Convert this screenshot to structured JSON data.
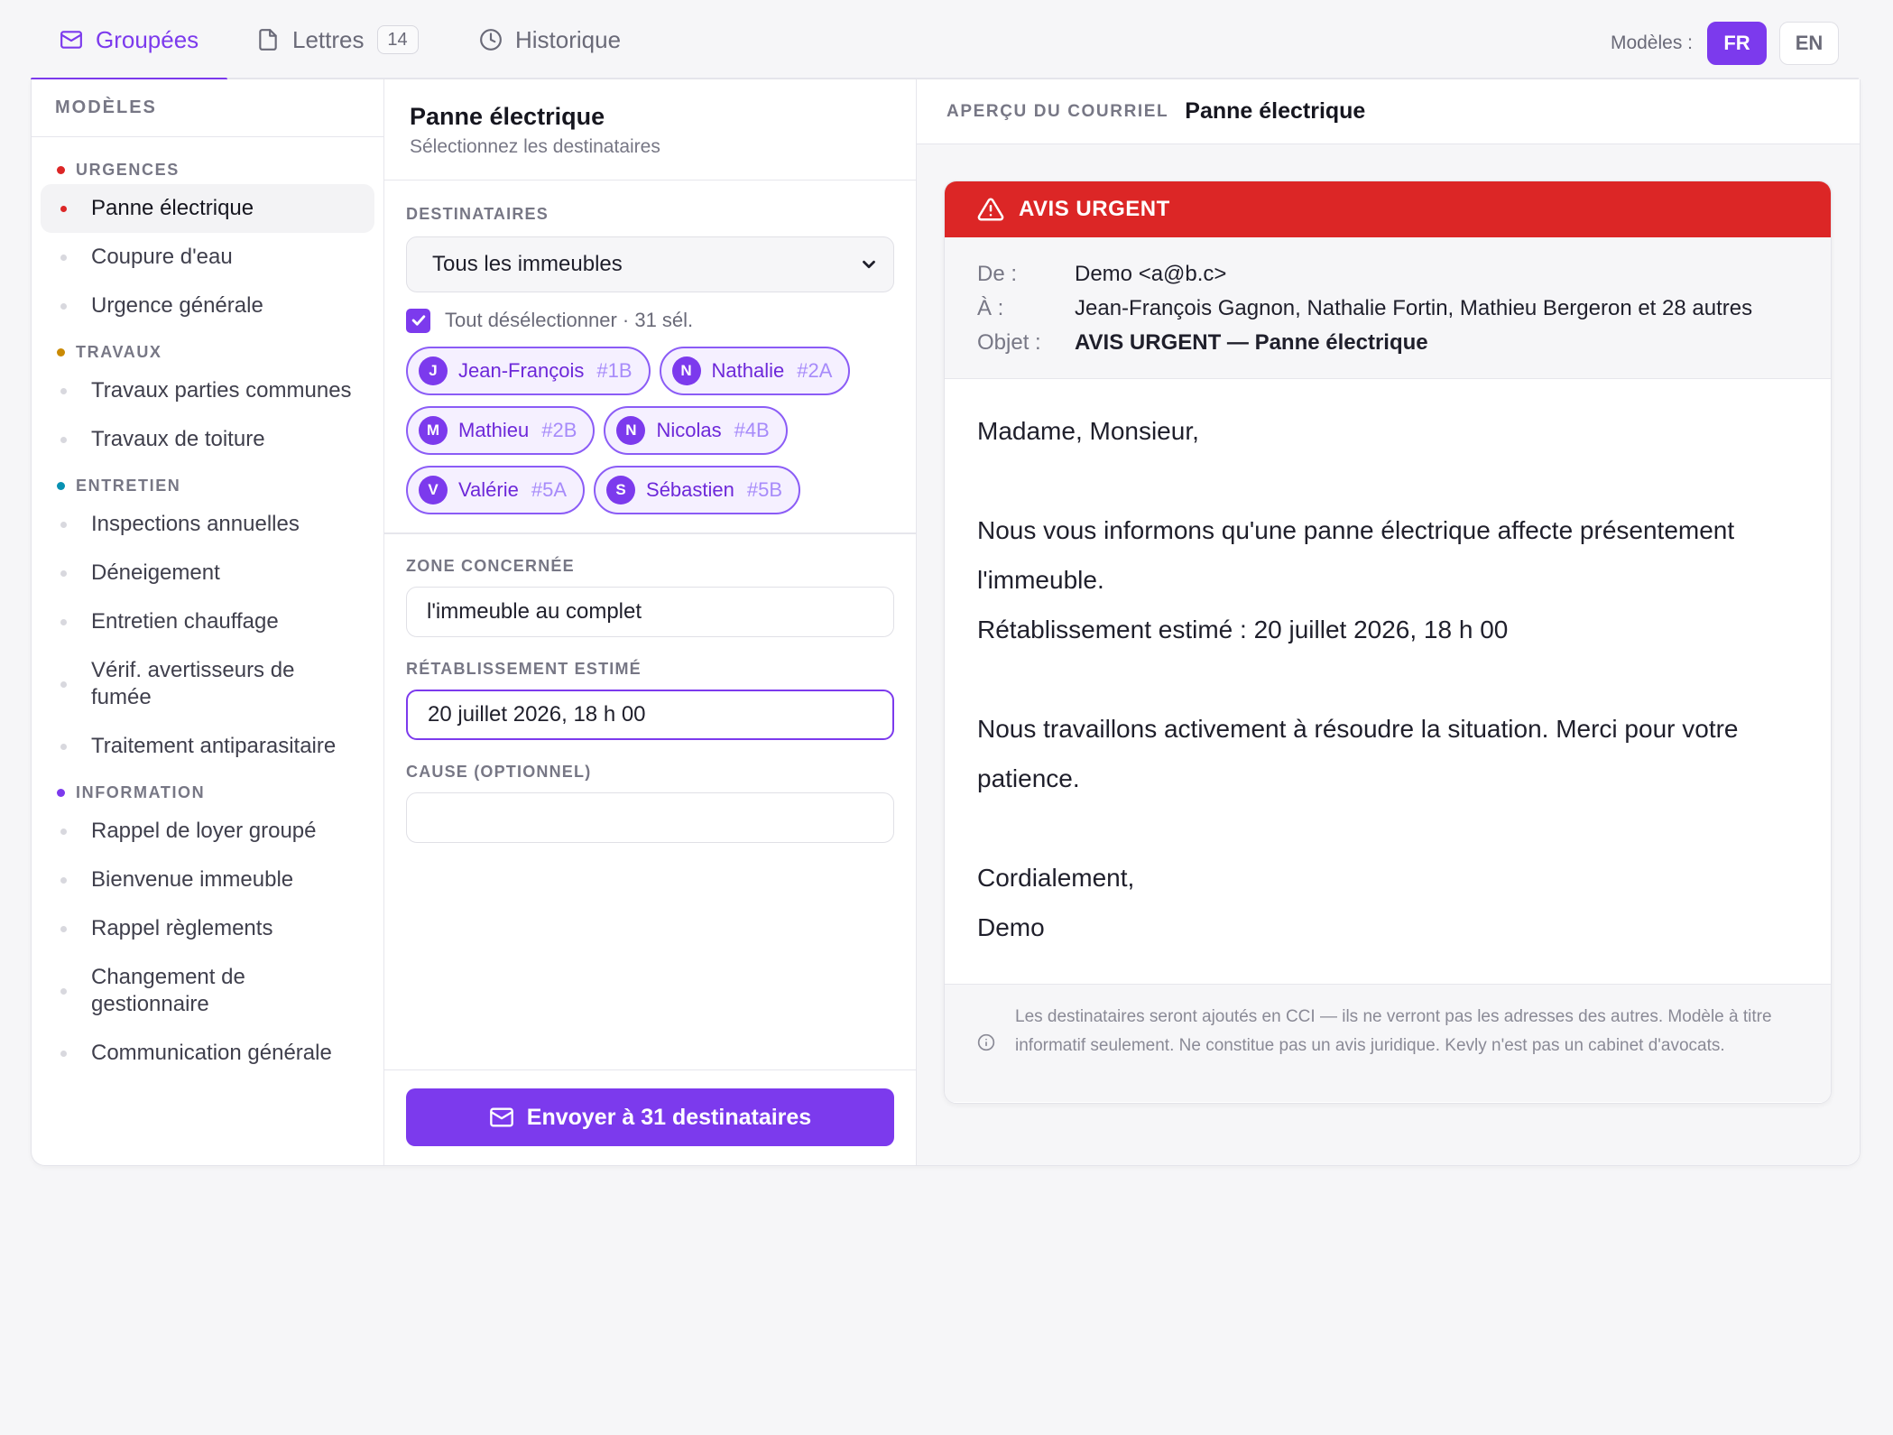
{
  "tabs": [
    {
      "label": "Groupées",
      "icon": "mail-icon"
    },
    {
      "label": "Lettres",
      "icon": "document-icon",
      "count": "14"
    },
    {
      "label": "Historique",
      "icon": "clock-icon"
    }
  ],
  "lang": {
    "label": "Modèles :",
    "options": [
      "FR",
      "EN"
    ],
    "selected": "FR"
  },
  "sidebar": {
    "title": "MODÈLES",
    "groups": [
      {
        "label": "URGENCES",
        "color": "#dc2626",
        "items": [
          "Panne électrique",
          "Coupure d'eau",
          "Urgence générale"
        ]
      },
      {
        "label": "TRAVAUX",
        "color": "#ca8a04",
        "items": [
          "Travaux parties communes",
          "Travaux de toiture"
        ]
      },
      {
        "label": "ENTRETIEN",
        "color": "#0891b2",
        "items": [
          "Inspections annuelles",
          "Déneigement",
          "Entretien chauffage",
          "Vérif. avertisseurs de fumée",
          "Traitement antiparasitaire"
        ]
      },
      {
        "label": "INFORMATION",
        "color": "#7c3aed",
        "items": [
          "Rappel de loyer groupé",
          "Bienvenue immeuble",
          "Rappel règlements",
          "Changement de gestionnaire",
          "Communication générale"
        ]
      }
    ],
    "active": "Panne électrique"
  },
  "form": {
    "title": "Panne électrique",
    "subtitle": "Sélectionnez les destinataires",
    "recipients_label": "DESTINATAIRES",
    "building_select": "Tous les immeubles",
    "deselect_all": "Tout désélectionner · 31 sél.",
    "chips": [
      {
        "initial": "J",
        "name": "Jean-François",
        "unit": "#1B"
      },
      {
        "initial": "N",
        "name": "Nathalie",
        "unit": "#2A"
      },
      {
        "initial": "M",
        "name": "Mathieu",
        "unit": "#2B"
      },
      {
        "initial": "N",
        "name": "Nicolas",
        "unit": "#4B"
      },
      {
        "initial": "V",
        "name": "Valérie",
        "unit": "#5A"
      },
      {
        "initial": "S",
        "name": "Sébastien",
        "unit": "#5B"
      }
    ],
    "zone_label": "ZONE CONCERNÉE",
    "zone_value": "l'immeuble au complet",
    "restore_label": "RÉTABLISSEMENT ESTIMÉ",
    "restore_value": "20 juillet 2026, 18 h 00",
    "cause_label": "CAUSE (OPTIONNEL)",
    "cause_value": "",
    "send_label": "Envoyer à 31 destinataires"
  },
  "preview": {
    "label": "APERÇU DU COURRIEL",
    "title": "Panne électrique",
    "banner": "AVIS URGENT",
    "from_key": "De :",
    "from": "Demo <a@b.c>",
    "to_key": "À :",
    "to": "Jean-François Gagnon, Nathalie Fortin, Mathieu Bergeron et 28 autres",
    "subject_key": "Objet :",
    "subject": "AVIS URGENT — Panne électrique",
    "body": {
      "greeting": "Madame, Monsieur,",
      "p1": "Nous vous informons qu'une panne électrique affecte présentement l'immeuble.",
      "p2": "Rétablissement estimé : 20 juillet 2026, 18 h 00",
      "p3": "Nous travaillons activement à résoudre la situation. Merci pour votre patience.",
      "closing": "Cordialement,",
      "signature": "Demo"
    },
    "disclaimer": "Les destinataires seront ajoutés en CCI — ils ne verront pas les adresses des autres. Modèle à titre informatif seulement. Ne constitue pas un avis juridique. Kevly n'est pas un cabinet d'avocats."
  }
}
